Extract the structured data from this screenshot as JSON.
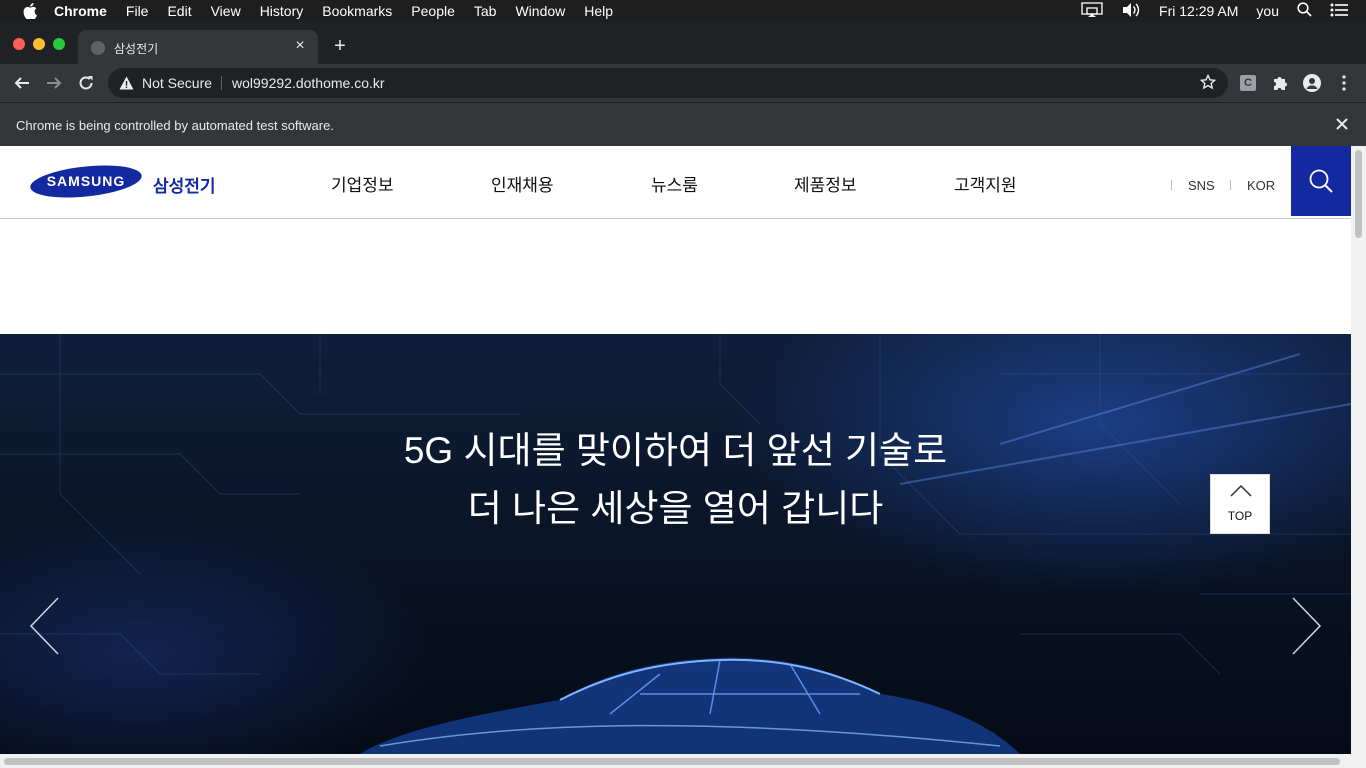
{
  "menubar": {
    "app": "Chrome",
    "items": [
      "File",
      "Edit",
      "View",
      "History",
      "Bookmarks",
      "People",
      "Tab",
      "Window",
      "Help"
    ],
    "clock": "Fri 12:29 AM",
    "user": "you"
  },
  "tab": {
    "title": "삼성전기",
    "close": "×"
  },
  "newtab_label": "+",
  "omnibox": {
    "security": "Not Secure",
    "url": "wol99292.dothome.co.kr"
  },
  "extensions": {
    "c_label": "C"
  },
  "infobar": {
    "message": "Chrome is being controlled by automated test software."
  },
  "site": {
    "logo_text": "SAMSUNG",
    "brand_kr": "삼성전기",
    "nav": [
      "기업정보",
      "인재채용",
      "뉴스룸",
      "제품정보",
      "고객지원"
    ],
    "util": [
      "SNS",
      "KOR"
    ],
    "hero_lines": [
      "5G 시대를 맞이하여 더 앞선 기술로",
      "더 나은 세상을 열어 갑니다"
    ],
    "top_label": "TOP"
  },
  "colors": {
    "brand_blue": "#1428a0",
    "chrome_dark": "#202124",
    "chrome_toolbar": "#35363a"
  }
}
